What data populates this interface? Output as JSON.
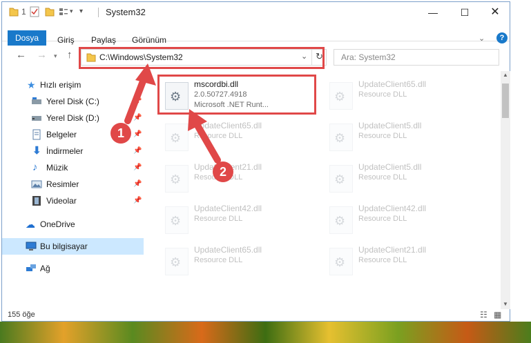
{
  "window": {
    "title": "System32",
    "quick_access_number": "1"
  },
  "ribbon": {
    "tabs": [
      "Dosya",
      "Giriş",
      "Paylaş",
      "Görünüm"
    ]
  },
  "address": {
    "path": "C:\\Windows\\System32"
  },
  "search": {
    "placeholder": "Ara: System32"
  },
  "sidebar": {
    "items": [
      {
        "label": "Hızlı erişim"
      },
      {
        "label": "Yerel Disk (C:)"
      },
      {
        "label": "Yerel Disk (D:)"
      },
      {
        "label": "Belgeler"
      },
      {
        "label": "İndirmeler"
      },
      {
        "label": "Müzik"
      },
      {
        "label": "Resimler"
      },
      {
        "label": "Videolar"
      },
      {
        "label": "OneDrive"
      },
      {
        "label": "Bu bilgisayar"
      },
      {
        "label": "Ağ"
      }
    ]
  },
  "files": [
    {
      "name": "mscordbi.dll",
      "line2": "2.0.50727.4918",
      "line3": "Microsoft .NET Runt..."
    },
    {
      "name": "UpdateClient65.dll",
      "line2": "Resource DLL"
    },
    {
      "name": "UpdateClient65.dll",
      "line2": "Resource DLL"
    },
    {
      "name": "UpdateClient5.dll",
      "line2": "Resource DLL"
    },
    {
      "name": "UpdateClient21.dll",
      "line2": "Resource DLL"
    },
    {
      "name": "UpdateClient5.dll",
      "line2": "Resource DLL"
    },
    {
      "name": "UpdateClient42.dll",
      "line2": "Resource DLL"
    },
    {
      "name": "UpdateClient42.dll",
      "line2": "Resource DLL"
    },
    {
      "name": "UpdateClient65.dll",
      "line2": "Resource DLL"
    },
    {
      "name": "UpdateClient21.dll",
      "line2": "Resource DLL"
    }
  ],
  "status": {
    "count": "155 öğe"
  },
  "annotations": {
    "step1": "1",
    "step2": "2"
  },
  "colors": {
    "accent": "#1979ca",
    "highlight": "#e04848",
    "selection": "#cce8ff"
  }
}
